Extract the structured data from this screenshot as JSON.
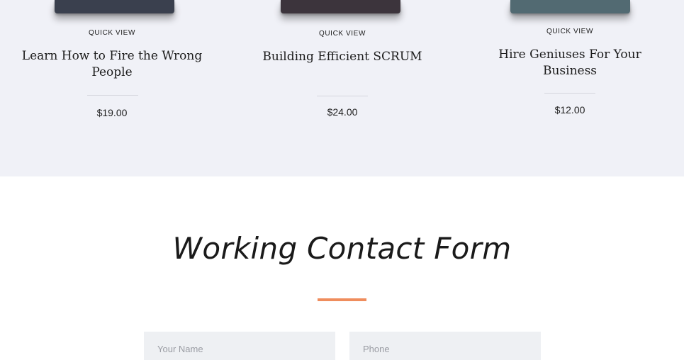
{
  "products": [
    {
      "quick_view": "QUICK VIEW",
      "title": "Learn How to Fire the Wrong People",
      "price": "$19.00",
      "cover_color": "#3a404e"
    },
    {
      "quick_view": "QUICK VIEW",
      "title": "Building Efficient SCRUM",
      "price": "$24.00",
      "cover_color": "#3c343c"
    },
    {
      "quick_view": "QUICK VIEW",
      "title": "Hire Geniuses For Your Business",
      "price": "$12.00",
      "cover_color": "#526a72"
    }
  ],
  "contact": {
    "title": "Working Contact Form",
    "accent_color": "#ef8d5d",
    "name_placeholder": "Your Name",
    "phone_placeholder": "Phone"
  }
}
